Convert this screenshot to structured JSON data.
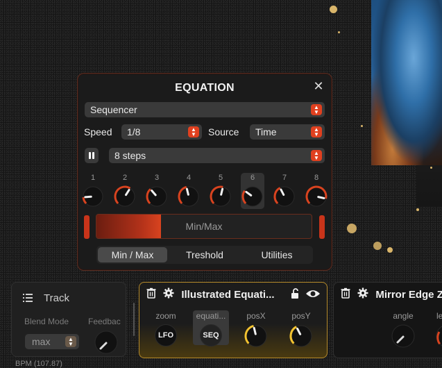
{
  "equation_modal": {
    "title": "EQUATION",
    "mode_select": "Sequencer",
    "speed_label": "Speed",
    "speed_value": "1/8",
    "source_label": "Source",
    "source_value": "Time",
    "steps_value": "8 steps",
    "steps": [
      {
        "num": "1",
        "value": 0.15
      },
      {
        "num": "2",
        "value": 0.62
      },
      {
        "num": "3",
        "value": 0.35
      },
      {
        "num": "4",
        "value": 0.45
      },
      {
        "num": "5",
        "value": 0.55
      },
      {
        "num": "6",
        "value": 0.3
      },
      {
        "num": "7",
        "value": 0.4
      },
      {
        "num": "8",
        "value": 0.88
      }
    ],
    "active_step": "6",
    "minmax_label": "Min/Max",
    "minmax_fill_fraction": 0.3,
    "tabs": [
      "Min / Max",
      "Treshold",
      "Utilities"
    ],
    "active_tab": "Min / Max"
  },
  "track_panel": {
    "title": "Track",
    "blend_mode_label": "Blend Mode",
    "blend_mode_value": "max",
    "feedback_label": "Feedbac"
  },
  "bpm_text": "BPM (107.87)",
  "illustrated_panel": {
    "title": "Illustrated Equati...",
    "params": [
      {
        "name": "zoom",
        "button": "LFO"
      },
      {
        "name": "equati...",
        "button": "SEQ"
      },
      {
        "name": "posX",
        "value": 0.45
      },
      {
        "name": "posY",
        "value": 0.4
      }
    ]
  },
  "mirror_panel": {
    "title": "Mirror Edge Z",
    "params": [
      {
        "name": "angle"
      },
      {
        "name": "le"
      }
    ]
  },
  "colors": {
    "accent": "#e0401f",
    "knob_active": "#d8431f",
    "panel_border_active": "#b58a2a",
    "knob_yellow": "#f2c230"
  }
}
